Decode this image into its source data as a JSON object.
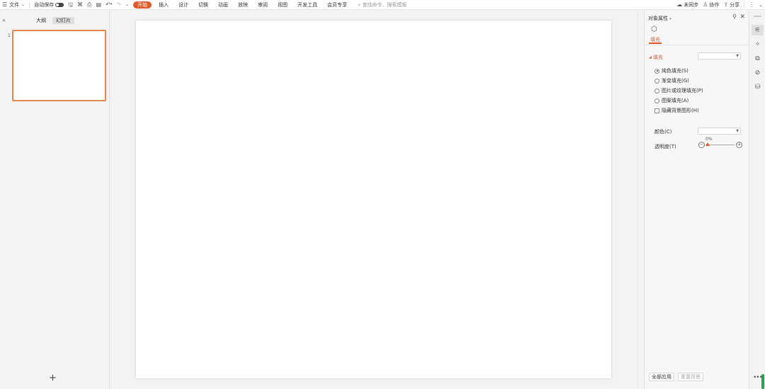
{
  "toolbar": {
    "file_label": "文件",
    "autosave_label": "自动保存",
    "tabs": [
      {
        "label": "开始",
        "active": true
      },
      {
        "label": "插入",
        "active": false
      },
      {
        "label": "设计",
        "active": false
      },
      {
        "label": "切换",
        "active": false
      },
      {
        "label": "动画",
        "active": false
      },
      {
        "label": "放映",
        "active": false
      },
      {
        "label": "审阅",
        "active": false
      },
      {
        "label": "视图",
        "active": false
      },
      {
        "label": "开发工具",
        "active": false
      },
      {
        "label": "会员专享",
        "active": false
      }
    ],
    "search_placeholder": "查找命令、搜索模板",
    "sync_label": "未同步",
    "collab_label": "协作",
    "share_label": "分享",
    "accent_color": "#e35a2a"
  },
  "left_panel": {
    "tabs": [
      {
        "label": "大纲",
        "active": false
      },
      {
        "label": "幻灯片",
        "active": true
      }
    ],
    "slides": [
      {
        "number": "1",
        "selected": true
      }
    ],
    "add_slide": "+"
  },
  "property_panel": {
    "title": "对象属性",
    "tab_label": "填充",
    "fill_header": "填充",
    "fill_options": [
      {
        "label": "纯色填充(S)",
        "type": "radio",
        "checked": true
      },
      {
        "label": "渐变填充(G)",
        "type": "radio",
        "checked": false
      },
      {
        "label": "图片或纹理填充(P)",
        "type": "radio",
        "checked": false
      },
      {
        "label": "图案填充(A)",
        "type": "radio",
        "checked": false
      },
      {
        "label": "隐藏背景图形(H)",
        "type": "checkbox",
        "checked": false
      }
    ],
    "color_label": "颜色(C)",
    "transparency_label": "透明度(T)",
    "transparency_value": "0%",
    "transparency_fraction": 0,
    "apply_all": "全部应用",
    "reset_bg": "重置背景"
  },
  "icons": {
    "menu": "hamburger-icon",
    "save": "save-icon",
    "undo": "undo-icon",
    "redo": "redo-icon",
    "search": "search-icon",
    "close": "close-icon"
  }
}
